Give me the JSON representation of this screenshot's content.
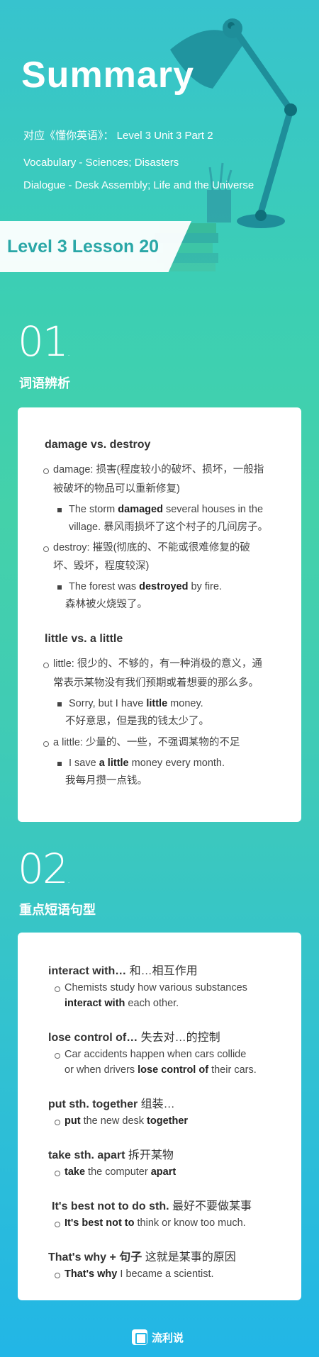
{
  "header": {
    "title": "Summary",
    "line1": "对应《懂你英语》： Level 3 Unit 3 Part 2",
    "line2": "Vocabulary - Sciences; Disasters",
    "line3": "Dialogue - Desk Assembly; Life and the Universe",
    "lesson": "Level 3 Lesson 20"
  },
  "section1": {
    "number": "01",
    "title": "词语辨析",
    "groups": [
      {
        "heading": "damage vs. destroy",
        "entries": [
          {
            "def1": "damage: 损害(程度较小的破坏、损坏，一般指",
            "def2": "被破坏的物品可以重新修复)",
            "ex_pre": "The storm ",
            "ex_bold": "damaged",
            "ex_post": " several houses in the",
            "ex2": "village. 暴风雨损坏了这个村子的几间房子。"
          },
          {
            "def1": "destroy: 摧毁(彻底的、不能或很难修复的破",
            "def2": "坏、毁坏，程度较深)",
            "ex_pre": "The forest was ",
            "ex_bold": "destroyed",
            "ex_post": " by fire.",
            "ex2": "森林被火烧毁了。"
          }
        ]
      },
      {
        "heading": "little vs. a little",
        "entries": [
          {
            "def1": "little: 很少的、不够的，有一种消极的意义，通",
            "def2": "常表示某物没有我们预期或着想要的那么多。",
            "ex_pre": "Sorry, but I have ",
            "ex_bold": "little",
            "ex_post": " money.",
            "ex2": "不好意思，但是我的钱太少了。"
          },
          {
            "def1": "a little: 少量的、一些，不强调某物的不足",
            "ex_pre": "I save ",
            "ex_bold": "a little",
            "ex_post": " money every month.",
            "ex2": "我每月攒一点钱。"
          }
        ]
      }
    ]
  },
  "section2": {
    "number": "02",
    "title": "重点短语句型",
    "items": [
      {
        "head_en": "interact with…",
        "head_cn": " 和…相互作用",
        "ex1_pre": "Chemists study how various substances",
        "ex2_bold": "interact with",
        "ex2_post": " each other."
      },
      {
        "head_en": "lose control of…",
        "head_cn": " 失去对…的控制",
        "ex1_pre": "Car accidents happen when cars collide",
        "ex2_pre": "or when drivers ",
        "ex2_bold": "lose control of",
        "ex2_post": " their cars."
      },
      {
        "head_en": "put sth. together",
        "head_cn": " 组装…",
        "ex_bold1": "put",
        "ex_mid": " the new desk ",
        "ex_bold2": "together"
      },
      {
        "head_en": "take sth. apart",
        "head_cn": " 拆开某物",
        "ex_bold1": "take",
        "ex_mid": " the computer ",
        "ex_bold2": "apart"
      },
      {
        "head_en": "It's best not to do sth.",
        "head_cn": " 最好不要做某事",
        "ex_bold1": "It's best not to",
        "ex_mid": " think or know too much."
      },
      {
        "head_en": "That's why + 句子",
        "head_cn": "  这就是某事的原因",
        "ex_bold1": "That's why",
        "ex_mid": " I became a scientist."
      }
    ]
  },
  "footer": {
    "brand": "流利说"
  },
  "colors": {
    "accent": "#2aa7a7",
    "lamp": "#1f8f9a"
  }
}
